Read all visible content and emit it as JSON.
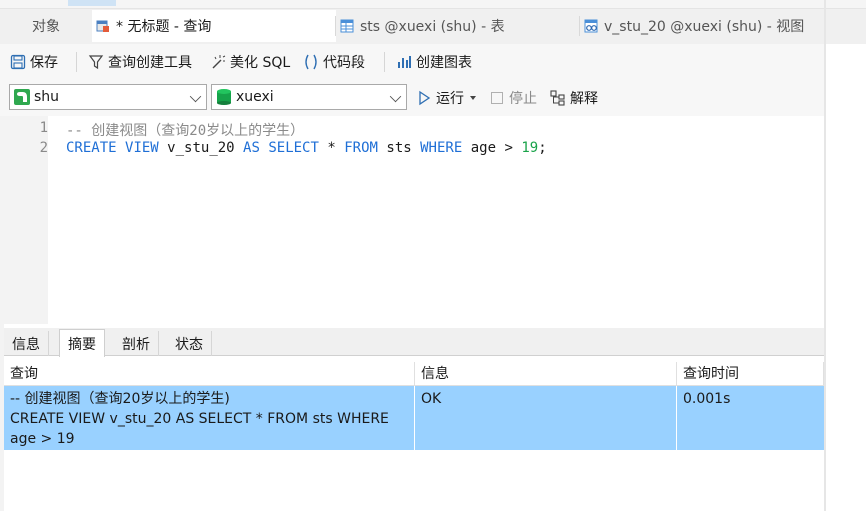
{
  "tabs": [
    {
      "label": "对象",
      "icon": "none"
    },
    {
      "label": "* 无标题 - 查询",
      "icon": "query-icon"
    },
    {
      "label": "sts @xuexi (shu) - 表",
      "icon": "table-icon"
    },
    {
      "label": "v_stu_20 @xuexi (shu) - 视图",
      "icon": "view-icon"
    }
  ],
  "toolbar": {
    "save": "保存",
    "query_builder": "查询创建工具",
    "beautify": "美化 SQL",
    "snippet": "代码段",
    "chart": "创建图表"
  },
  "toolbar2": {
    "connection": "shu",
    "database": "xuexi",
    "run": "运行",
    "stop": "停止",
    "explain": "解释"
  },
  "editor": {
    "line_numbers": [
      "1",
      "2"
    ],
    "line1_comment": "-- 创建视图（查询20岁以上的学生）",
    "line2": {
      "kw_create": "CREATE",
      "kw_view": "VIEW",
      "name": "v_stu_20",
      "kw_as": "AS",
      "kw_select": "SELECT",
      "star": "*",
      "kw_from": "FROM",
      "table": "sts",
      "kw_where": "WHERE",
      "col": "age",
      "op": ">",
      "num": "19",
      "semi": ";"
    }
  },
  "result_tabs": [
    "信息",
    "摘要",
    "剖析",
    "状态"
  ],
  "result_table": {
    "headers": [
      "查询",
      "信息",
      "查询时间"
    ],
    "row": {
      "query_lines": [
        "-- 创建视图（查询20岁以上的学生)",
        "CREATE VIEW v_stu_20 AS SELECT * FROM sts WHERE",
        "age > 19"
      ],
      "info": "OK",
      "time": "0.001s"
    }
  },
  "colors": {
    "selected_row": "#99d1ff",
    "keyword": "#1f6fd6",
    "number": "#1aa34a",
    "comment": "#8a8a8a"
  }
}
